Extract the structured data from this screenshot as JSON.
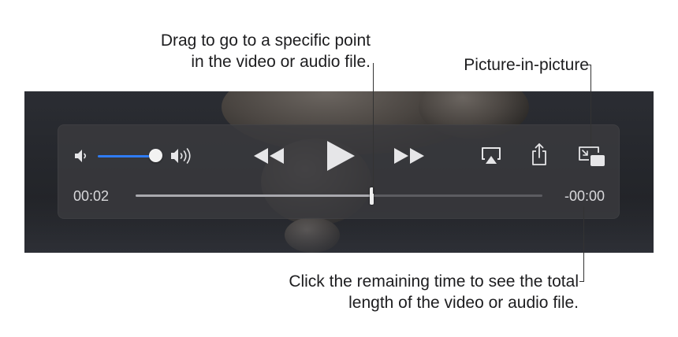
{
  "callouts": {
    "scrub": {
      "line1": "Drag to go to a specific point",
      "line2": "in the video or audio file."
    },
    "pip": {
      "line1": "Picture-in-picture"
    },
    "remaining": {
      "line1": "Click the remaining time to see the total",
      "line2": "length of the video or audio file."
    }
  },
  "player": {
    "time_elapsed": "00:02",
    "time_remaining": "-00:00",
    "volume_level": 0.87,
    "playback_progress": 0.58,
    "icons": {
      "volume_low": "speaker-low-icon",
      "volume_high": "speaker-high-icon",
      "rewind": "rewind-icon",
      "play": "play-icon",
      "fast_forward": "fast-forward-icon",
      "airplay": "airplay-icon",
      "share": "share-icon",
      "pip": "picture-in-picture-icon"
    },
    "colors": {
      "volume_accent": "#2f7cf6",
      "hud_background": "#3a3a3e",
      "icon": "#e6e6e8"
    }
  }
}
